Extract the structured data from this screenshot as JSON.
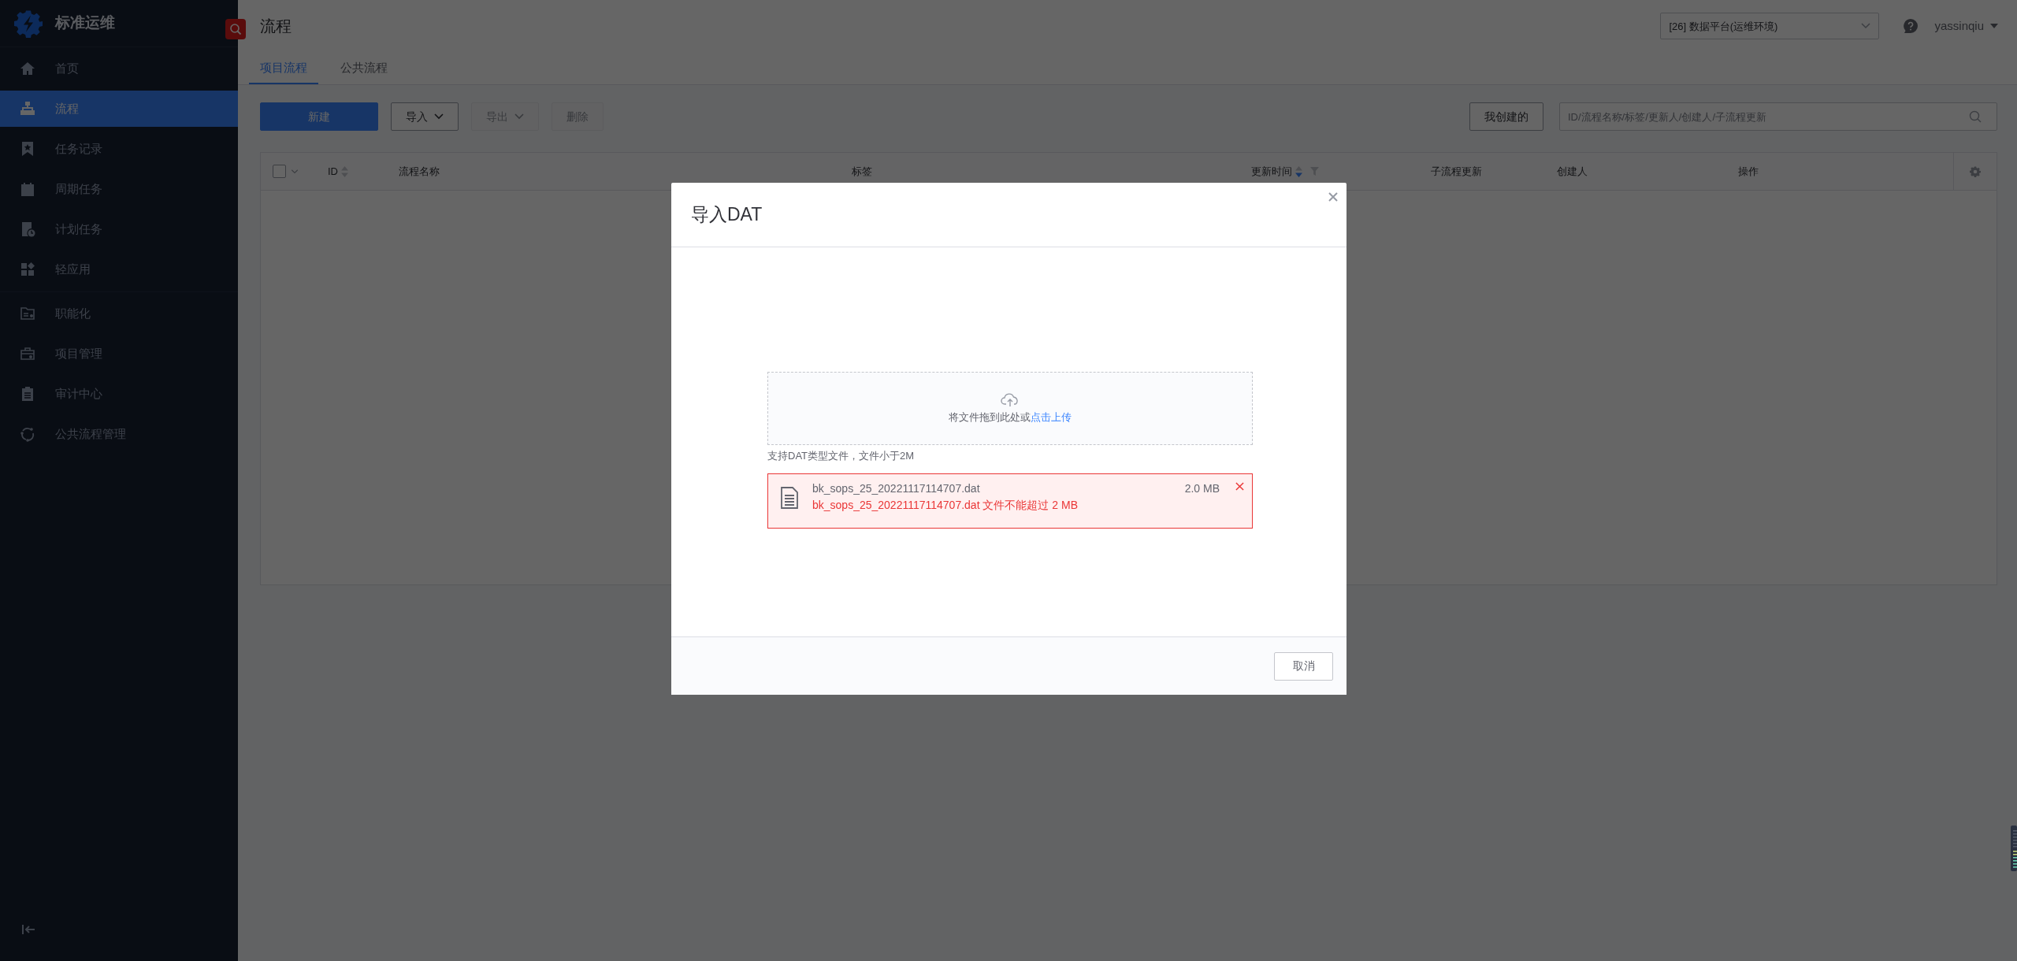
{
  "sidebar": {
    "title": "标准运维",
    "sections": [
      {
        "items": [
          {
            "label": "首页",
            "selected": false
          },
          {
            "label": "流程",
            "selected": true
          },
          {
            "label": "任务记录",
            "selected": false
          },
          {
            "label": "周期任务",
            "selected": false
          },
          {
            "label": "计划任务",
            "selected": false
          },
          {
            "label": "轻应用",
            "selected": false
          }
        ]
      },
      {
        "items": [
          {
            "label": "职能化",
            "selected": false
          },
          {
            "label": "项目管理",
            "selected": false
          },
          {
            "label": "审计中心",
            "selected": false
          },
          {
            "label": "公共流程管理",
            "selected": false
          }
        ]
      }
    ]
  },
  "header": {
    "title": "流程",
    "project_select": "[26] 数据平台(运维环境)",
    "user": "yassinqiu"
  },
  "tabs": [
    {
      "label": "项目流程",
      "selected": true
    },
    {
      "label": "公共流程",
      "selected": false
    }
  ],
  "toolbar": {
    "buttons": [
      {
        "label": "新建",
        "kind": "primary",
        "disabled": false
      },
      {
        "label": "导入",
        "kind": "dropdown",
        "disabled": false
      },
      {
        "label": "导出",
        "kind": "dropdown",
        "disabled": true
      },
      {
        "label": "删除",
        "kind": "plain",
        "disabled": true
      }
    ],
    "filter_button": "我创建的",
    "search": {
      "placeholder": "ID/流程名称/标签/更新人/创建人/子流程更新"
    }
  },
  "table": {
    "select_all": {
      "checked": false
    },
    "columns": [
      {
        "label": "ID",
        "sortable": true,
        "sorted": false,
        "filterable": false
      },
      {
        "label": "流程名称",
        "sortable": false,
        "sorted": false,
        "filterable": false
      },
      {
        "label": "标签",
        "sortable": false,
        "sorted": false,
        "filterable": false
      },
      {
        "label": "更新时间",
        "sortable": true,
        "sorted": true,
        "filterable": true
      },
      {
        "label": "子流程更新",
        "sortable": false,
        "sorted": false,
        "filterable": false
      },
      {
        "label": "创建人",
        "sortable": false,
        "sorted": false,
        "filterable": false
      },
      {
        "label": "操作",
        "sortable": false,
        "sorted": false,
        "filterable": false
      }
    ]
  },
  "modal": {
    "title": "导入DAT",
    "dropzone": {
      "text": "将文件拖到此处或",
      "link": "点击上传"
    },
    "hint": "支持DAT类型文件，文件小于2M",
    "files": [
      {
        "name": "bk_sops_25_20221117114707.dat",
        "size": "2.0 MB",
        "failed": true,
        "error": "bk_sops_25_20221117114707.dat 文件不能超过 2 MB"
      }
    ],
    "buttons": [
      {
        "label": "取消"
      }
    ]
  }
}
